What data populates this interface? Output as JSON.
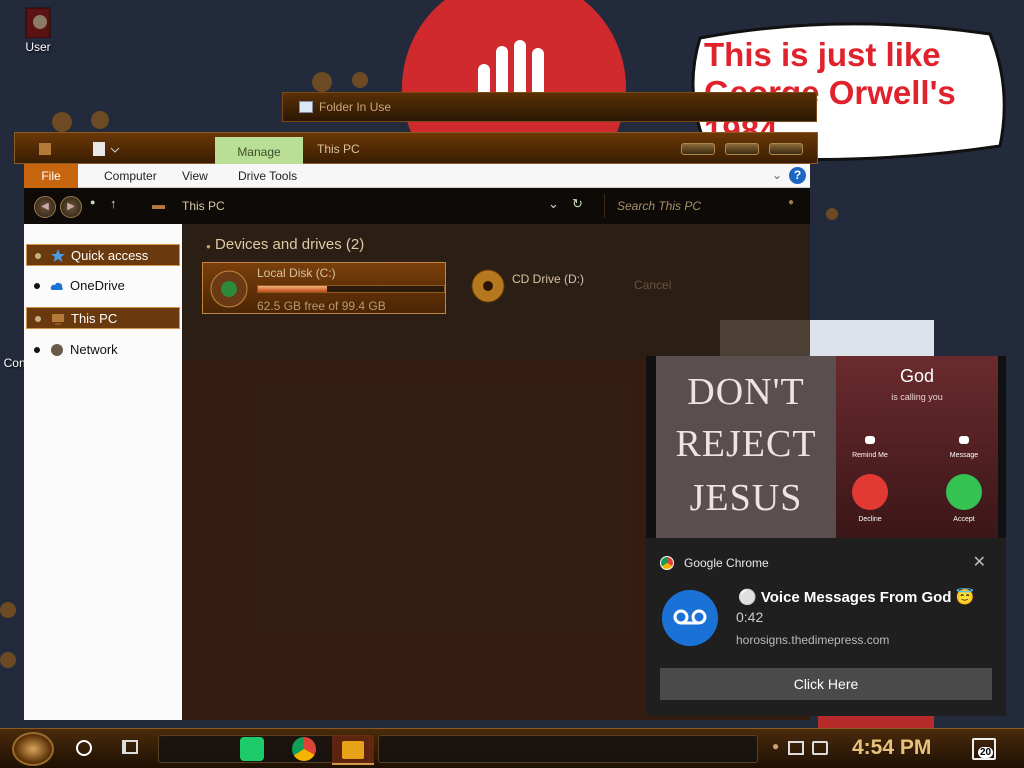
{
  "desktop": {
    "icons": [
      {
        "label": "User",
        "icon": "user-folder-icon"
      },
      {
        "label": "Control Panel",
        "icon": "control-panel-icon"
      }
    ],
    "speech_bubble": {
      "lines": [
        "This is just like",
        "George Orwell's",
        "1984"
      ],
      "color": "#e0222c"
    }
  },
  "back_window": {
    "title": "Folder In Use"
  },
  "explorer": {
    "title": "This PC",
    "manage_tab": "Manage",
    "ribbon_tabs": [
      "File",
      "Computer",
      "View",
      "Drive Tools"
    ],
    "help": "?",
    "address": "This PC",
    "search_placeholder": "Search This PC",
    "nav": [
      {
        "label": "Quick access",
        "icon": "star-icon"
      },
      {
        "label": "OneDrive",
        "icon": "cloud-icon"
      },
      {
        "label": "This PC",
        "icon": "computer-icon"
      },
      {
        "label": "Network",
        "icon": "network-icon"
      }
    ],
    "section_title": "Devices and drives (2)",
    "drives": [
      {
        "name": "Local Disk (C:)",
        "free": "62.5 GB free of 99.4 GB",
        "used_fraction": 0.37
      },
      {
        "name": "CD Drive (D:)"
      }
    ],
    "faint_button": "Cancel"
  },
  "promo": {
    "left_lines": [
      "DON'T",
      "REJECT",
      "JESUS"
    ],
    "caller": "God",
    "calling_text": "is calling you",
    "remind": "Remind Me",
    "message": "Message",
    "decline": "Decline",
    "accept": "Accept"
  },
  "toast": {
    "app": "Google Chrome",
    "title": "⚪ Voice Messages From God 😇",
    "duration": "0:42",
    "domain": "horosigns.thedimepress.com",
    "button": "Click Here"
  },
  "taskbar": {
    "time": "4:54 PM",
    "notification_count": "20",
    "accent": "#e7c27c"
  }
}
